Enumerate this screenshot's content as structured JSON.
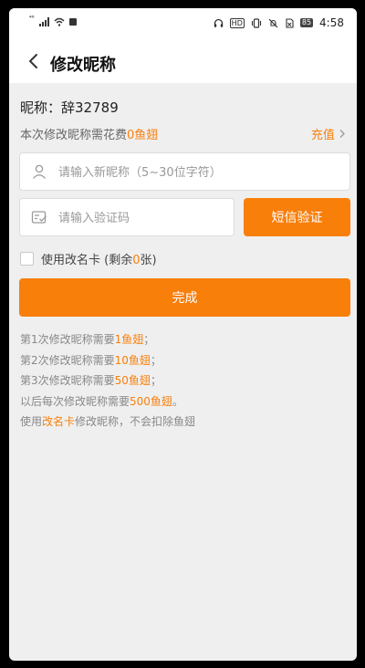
{
  "status_bar": {
    "signal_text": "⁴⁶",
    "hd_label": "HD",
    "battery": "85",
    "time": "4:58"
  },
  "nav": {
    "title": "修改昵称"
  },
  "nickname": {
    "label": "昵称：",
    "value": "辞32789"
  },
  "cost": {
    "prefix": "本次修改昵称需花费",
    "amount": "0鱼翅"
  },
  "recharge_label": "充值 ",
  "form": {
    "nickname_placeholder": "请输入新昵称（5~30位字符）",
    "code_placeholder": "请输入验证码",
    "sms_button": "短信验证"
  },
  "rename_card": {
    "label_prefix": "使用改名卡 (剩余",
    "count": "0",
    "label_suffix": "张)"
  },
  "done_button": "完成",
  "rules": [
    {
      "prefix": "第1次修改昵称需要",
      "highlight": "1鱼翅",
      "suffix": "；"
    },
    {
      "prefix": "第2次修改昵称需要",
      "highlight": "10鱼翅",
      "suffix": "；"
    },
    {
      "prefix": "第3次修改昵称需要",
      "highlight": "50鱼翅",
      "suffix": "；"
    },
    {
      "prefix": "以后每次修改昵称需要",
      "highlight": "500鱼翅",
      "suffix": "。"
    },
    {
      "prefix": "使用",
      "highlight": "改名卡",
      "suffix": "修改昵称，不会扣除鱼翅"
    }
  ],
  "colors": {
    "accent": "#f97f0b",
    "background": "#efefef"
  }
}
